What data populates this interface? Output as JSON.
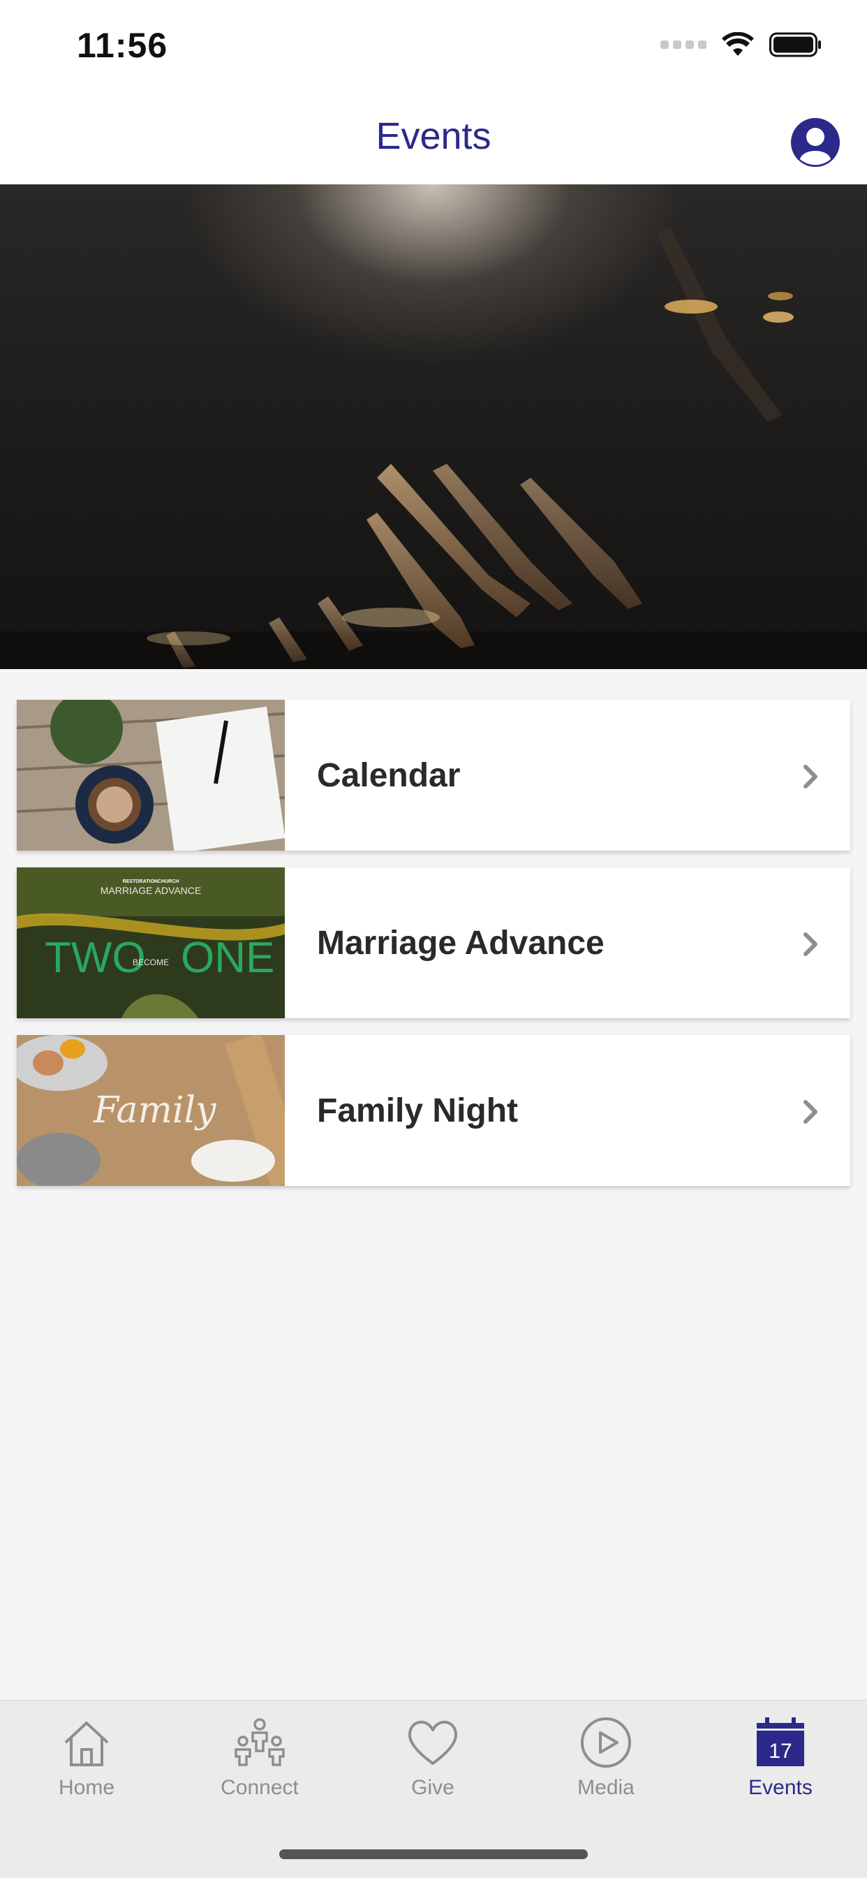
{
  "status_bar": {
    "time": "11:56"
  },
  "nav": {
    "title": "Events"
  },
  "events": [
    {
      "label": "Calendar"
    },
    {
      "label": "Marriage Advance",
      "thumb_title": "MARRIAGE ADVANCE",
      "thumb_big_left": "TWO",
      "thumb_big_right": "ONE",
      "thumb_small": "BECOME",
      "thumb_brand": "RESTORATIONCHURCH"
    },
    {
      "label": "Family Night",
      "thumb_script": "Family"
    }
  ],
  "tabs": [
    {
      "label": "Home",
      "icon": "home-icon"
    },
    {
      "label": "Connect",
      "icon": "people-icon"
    },
    {
      "label": "Give",
      "icon": "heart-icon"
    },
    {
      "label": "Media",
      "icon": "play-icon"
    },
    {
      "label": "Events",
      "icon": "calendar-icon",
      "calendar_day": "17",
      "active": true
    }
  ],
  "colors": {
    "accent": "#2b2a8a",
    "inactive": "#8e8e8e"
  }
}
